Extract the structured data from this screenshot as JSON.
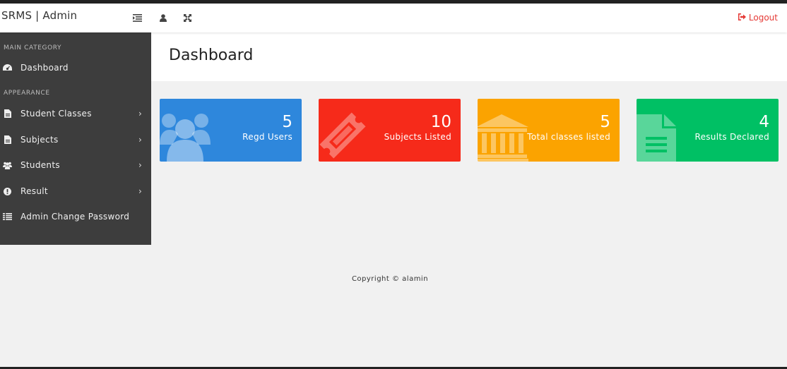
{
  "header": {
    "brand": "SRMS | Admin",
    "icons": [
      "menu-toggle-icon",
      "user-icon",
      "fullscreen-icon"
    ],
    "logout_label": "Logout",
    "logout_color": "#e53935"
  },
  "sidebar": {
    "main_category_label": "MAIN CATEGORY",
    "appearance_label": "APPEARANCE",
    "items": [
      {
        "label": "Dashboard",
        "icon": "dashboard-icon",
        "has_children": false
      },
      {
        "label": "Student Classes",
        "icon": "file-icon",
        "has_children": true
      },
      {
        "label": "Subjects",
        "icon": "file-icon",
        "has_children": true
      },
      {
        "label": "Students",
        "icon": "users-icon",
        "has_children": true
      },
      {
        "label": "Result",
        "icon": "info-icon",
        "has_children": true
      },
      {
        "label": "Admin Change Password",
        "icon": "list-icon",
        "has_children": false
      }
    ],
    "chevron": "›"
  },
  "page": {
    "title": "Dashboard"
  },
  "stats": [
    {
      "value": "5",
      "caption": "Regd Users",
      "color": "#2e87dc",
      "icon": "users-icon"
    },
    {
      "value": "10",
      "caption": "Subjects Listed",
      "color": "#f62a1a",
      "icon": "ticket-icon"
    },
    {
      "value": "5",
      "caption": "Total classes listed",
      "color": "#fba300",
      "icon": "bank-icon"
    },
    {
      "value": "4",
      "caption": "Results Declared",
      "color": "#00c064",
      "icon": "document-icon"
    }
  ],
  "footer": {
    "text": "Copyright © alamin"
  }
}
